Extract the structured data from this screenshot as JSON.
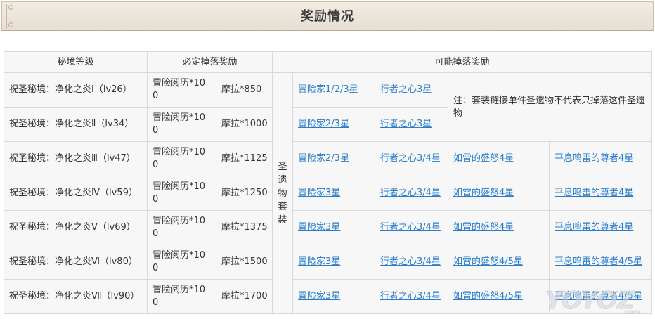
{
  "header": {
    "title": "奖励情况"
  },
  "table": {
    "columns": [
      "秘境等级",
      "必定掉落奖励",
      "可能掉落奖励"
    ],
    "set_label": "圣遗物套装",
    "note": "注：套装链接单件圣遗物不代表只掉落这件圣遗物",
    "rows": [
      {
        "stage": "祝圣秘境：净化之炎Ⅰ（lv26）",
        "exp": "冒险阅历*100",
        "mora": "摩拉*850",
        "items": [
          "冒险家1/2/3星",
          "行者之心3星"
        ]
      },
      {
        "stage": "祝圣秘境：净化之炎Ⅱ（lv34）",
        "exp": "冒险阅历*100",
        "mora": "摩拉*1000",
        "items": [
          "冒险家2/3星",
          "行者之心3星"
        ]
      },
      {
        "stage": "祝圣秘境：净化之炎Ⅲ（lv47）",
        "exp": "冒险阅历*100",
        "mora": "摩拉*1125",
        "items": [
          "冒险家2/3星",
          "行者之心3/4星",
          "如雷的盛怒4星",
          "平息鸣雷的尊者4星"
        ]
      },
      {
        "stage": "祝圣秘境：净化之炎Ⅳ（lv59）",
        "exp": "冒险阅历*100",
        "mora": "摩拉*1250",
        "items": [
          "冒险家3星",
          "行者之心3/4星",
          "如雷的盛怒4星",
          "平息鸣雷的尊者4星"
        ]
      },
      {
        "stage": "祝圣秘境：净化之炎Ⅴ（lv69）",
        "exp": "冒险阅历*100",
        "mora": "摩拉*1375",
        "items": [
          "冒险家3星",
          "行者之心3/4星",
          "如雷的盛怒4星",
          "平息鸣雷的尊者4星"
        ]
      },
      {
        "stage": "祝圣秘境：净化之炎Ⅵ（lv80）",
        "exp": "冒险阅历*100",
        "mora": "摩拉*1500",
        "items": [
          "冒险家3星",
          "行者之心3/4星",
          "如雷的盛怒4/5星",
          "平息鸣雷的尊者4/5星"
        ]
      },
      {
        "stage": "祝圣秘境：净化之炎Ⅶ（lv90）",
        "exp": "冒险阅历*100",
        "mora": "摩拉*1700",
        "items": [
          "冒险家3星",
          "行者之心3/4星",
          "如雷的盛怒4/5星",
          "平息鸣雷的尊者4/5星"
        ]
      }
    ]
  },
  "watermark": {
    "text": "YOYOZ.com"
  }
}
